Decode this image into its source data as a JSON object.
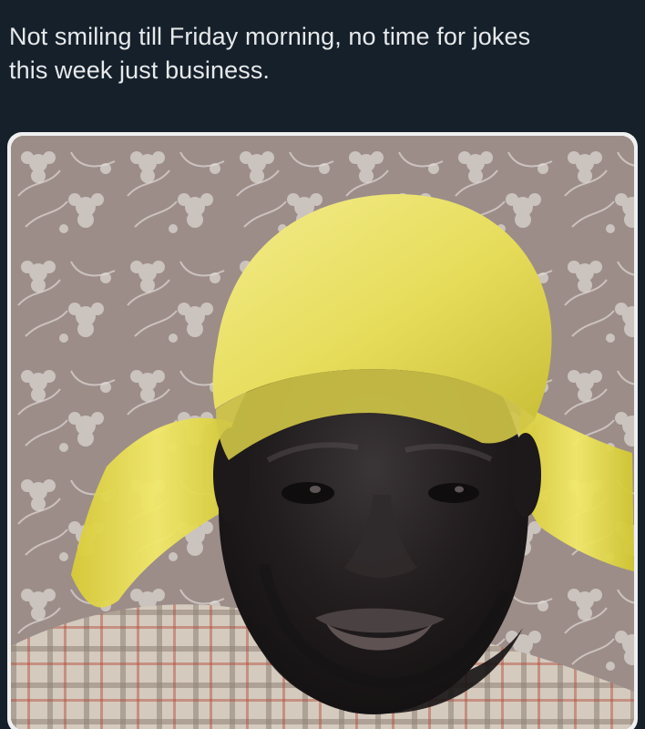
{
  "post": {
    "text": "Not smiling till Friday morning, no time for jokes\nthis week just business."
  },
  "media": {
    "image_kind": "photo",
    "colors": {
      "frame": "#f0f0f0",
      "wallpaper": "#9c8d89",
      "wallpaper_pattern": "#d6cfca",
      "headwrap": "#e6dc5a",
      "skin": "#2a2526",
      "shirt": "#cfc4b8"
    }
  }
}
